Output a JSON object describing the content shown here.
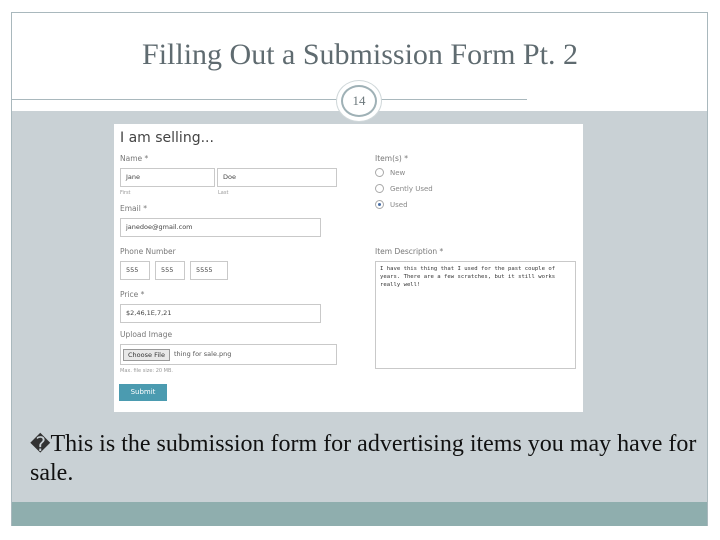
{
  "slide": {
    "title": "Filling Out a Submission Form Pt. 2",
    "page_number": "14",
    "bullet_glyph": "�",
    "bullet": "This is the submission form for advertising items you may have for sale."
  },
  "form": {
    "heading": "I am selling...",
    "name_label": "Name *",
    "first_value": "Jane",
    "last_value": "Doe",
    "first_sub": "First",
    "last_sub": "Last",
    "email_label": "Email *",
    "email_value": "janedoe@gmail.com",
    "phone_label": "Phone Number",
    "phone_parts": [
      "555",
      "555",
      "5555"
    ],
    "price_label": "Price *",
    "price_value": "$2,46,1E,7,21",
    "upload_label": "Upload Image",
    "choose_file": "Choose File",
    "file_name": "thing for sale.png",
    "upload_hint": "Max. file size: 20 MB.",
    "items_label": "Item(s) *",
    "conditions": [
      {
        "label": "New",
        "selected": false
      },
      {
        "label": "Gently Used",
        "selected": false
      },
      {
        "label": "Used",
        "selected": true
      }
    ],
    "description_label": "Item Description *",
    "description_value": "I have this thing that I used for the past couple of years. There are a few scratches, but it still works really well!",
    "submit": "Submit"
  },
  "colors": {
    "content_bg": "#c9d1d5",
    "footer": "#8faeae",
    "submit": "#4b9bb0",
    "title": "#5f6b70"
  }
}
